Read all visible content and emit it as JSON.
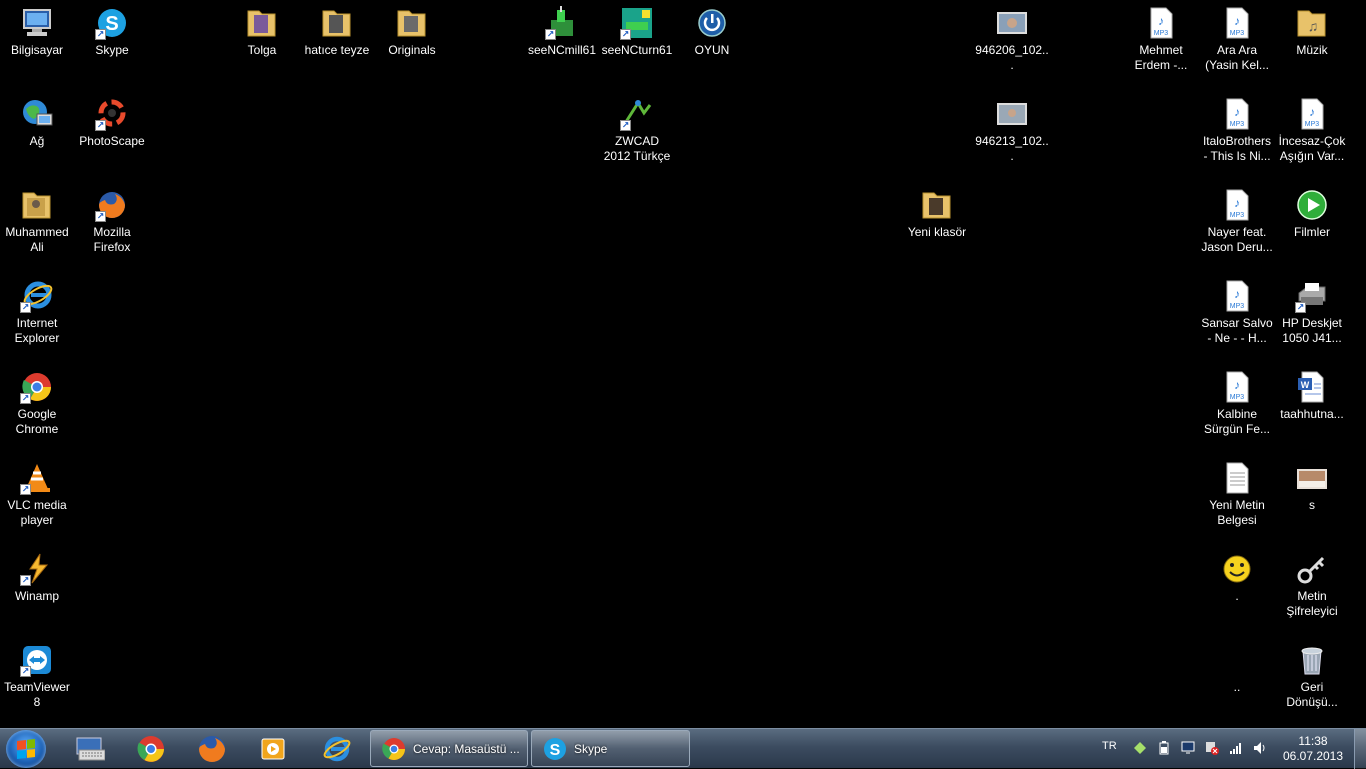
{
  "desktop": {
    "icons": [
      {
        "label": "Bilgisayar",
        "icon": "computer-icon"
      },
      {
        "label": "Skype",
        "icon": "skype-icon"
      },
      {
        "label": "Tolga",
        "icon": "folder-icon"
      },
      {
        "label": "hatıce teyze",
        "icon": "folder-icon"
      },
      {
        "label": "Originals",
        "icon": "folder-icon"
      },
      {
        "label": "seeNCmill61",
        "icon": "cnc-mill-icon"
      },
      {
        "label": "seeNCturn61",
        "icon": "cnc-turn-icon"
      },
      {
        "label": "OYUN",
        "icon": "power-icon"
      },
      {
        "label": "946206_102...",
        "icon": "photo-icon"
      },
      {
        "label": "Mehmet Erdem -...",
        "icon": "mp3-icon"
      },
      {
        "label": "Ara Ara (Yasin Kel...",
        "icon": "mp3-icon"
      },
      {
        "label": "Müzik",
        "icon": "music-folder-icon"
      },
      {
        "label": "Ağ",
        "icon": "network-icon"
      },
      {
        "label": "PhotoScape",
        "icon": "photoscape-icon"
      },
      {
        "label": "ZWCAD 2012 Türkçe Aka...",
        "icon": "zwcad-icon"
      },
      {
        "label": "946213_102...",
        "icon": "photo-icon"
      },
      {
        "label": "ItaloBrothers - This Is Ni...",
        "icon": "mp3-icon"
      },
      {
        "label": "İncesaz-Çok Aşığın Var...",
        "icon": "mp3-icon"
      },
      {
        "label": "Muhammed Ali",
        "icon": "folder-icon"
      },
      {
        "label": "Mozilla Firefox",
        "icon": "firefox-icon"
      },
      {
        "label": "Yeni klasör",
        "icon": "folder-icon"
      },
      {
        "label": "Nayer feat. Jason Deru...",
        "icon": "mp3-icon"
      },
      {
        "label": "Filmler",
        "icon": "play-icon"
      },
      {
        "label": "Internet Explorer",
        "icon": "ie-icon"
      },
      {
        "label": "Sansar Salvo - Ne - - H...",
        "icon": "mp3-icon"
      },
      {
        "label": "HP Deskjet 1050 J41...",
        "icon": "printer-icon"
      },
      {
        "label": "Google Chrome",
        "icon": "chrome-icon"
      },
      {
        "label": "Kalbine Sürgün Fe...",
        "icon": "mp3-icon"
      },
      {
        "label": "taahhutna...",
        "icon": "word-doc-icon"
      },
      {
        "label": "VLC media player",
        "icon": "vlc-icon"
      },
      {
        "label": "Yeni Metin Belgesi",
        "icon": "text-file-icon"
      },
      {
        "label": "s",
        "icon": "photo-icon"
      },
      {
        "label": "Winamp",
        "icon": "winamp-icon"
      },
      {
        "label": ".",
        "icon": "smiley-icon"
      },
      {
        "label": "Metin Şifreleyici",
        "icon": "key-icon"
      },
      {
        "label": "TeamViewer 8",
        "icon": "teamviewer-icon"
      },
      {
        "label": "..",
        "icon": "blank-icon"
      },
      {
        "label": "Geri Dönüşü...",
        "icon": "recycle-bin-icon"
      }
    ]
  },
  "taskbar": {
    "pinned": [
      {
        "name": "Ekran klavyesi",
        "icon": "keyboard-icon"
      },
      {
        "name": "Google Chrome",
        "icon": "chrome-icon"
      },
      {
        "name": "Mozilla Firefox",
        "icon": "firefox-icon"
      },
      {
        "name": "Windows Media",
        "icon": "media-player-icon"
      },
      {
        "name": "Internet Explorer",
        "icon": "ie-icon"
      }
    ],
    "tasks": [
      {
        "label": "Cevap: Masaüstü ...",
        "icon": "chrome-icon"
      },
      {
        "label": "Skype",
        "icon": "skype-icon"
      }
    ],
    "tray": {
      "language": "TR",
      "icons": [
        "skype-tray-icon",
        "battery-icon",
        "action-center-icon",
        "network-warning-icon",
        "signal-icon",
        "volume-icon"
      ],
      "time": "11:38",
      "date": "06.07.2013"
    }
  }
}
